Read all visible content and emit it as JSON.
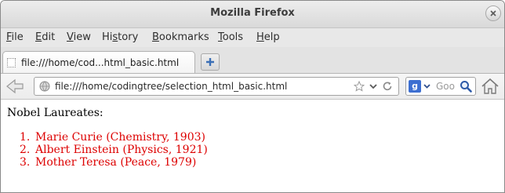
{
  "window": {
    "title": "Mozilla Firefox"
  },
  "menubar": {
    "items": [
      {
        "label": "File",
        "accel": "F",
        "rest": "ile"
      },
      {
        "label": "Edit",
        "accel": "E",
        "rest": "dit"
      },
      {
        "label": "View",
        "accel": "V",
        "rest": "iew"
      },
      {
        "label": "History",
        "pre": "Hi",
        "accel": "s",
        "rest": "tory"
      },
      {
        "label": "Bookmarks",
        "accel": "B",
        "rest": "ookmarks"
      },
      {
        "label": "Tools",
        "accel": "T",
        "rest": "ools"
      },
      {
        "label": "Help",
        "accel": "H",
        "rest": "elp"
      }
    ]
  },
  "tabs": [
    {
      "label": "file:///home/cod...html_basic.html",
      "active": true
    }
  ],
  "navbar": {
    "url": "file:///home/codingtree/selection_html_basic.html",
    "search_placeholder": "Goo",
    "search_engine_letter": "g"
  },
  "page": {
    "heading": "Nobel Laureates:",
    "list_color": "#dd0000",
    "laureates": [
      {
        "number": "1.",
        "text": "Marie Curie (Chemistry, 1903)"
      },
      {
        "number": "2.",
        "text": "Albert Einstein (Physics, 1921)"
      },
      {
        "number": "3.",
        "text": "Mother Teresa (Peace, 1979)"
      }
    ]
  },
  "icons": {
    "close": "close-icon",
    "new_tab": "plus-icon",
    "back": "back-arrow-icon",
    "site_identity": "globe-icon",
    "bookmark": "star-icon",
    "history_dropdown": "chevron-down-icon",
    "reload": "reload-icon",
    "search": "magnifier-icon",
    "home": "home-icon"
  }
}
